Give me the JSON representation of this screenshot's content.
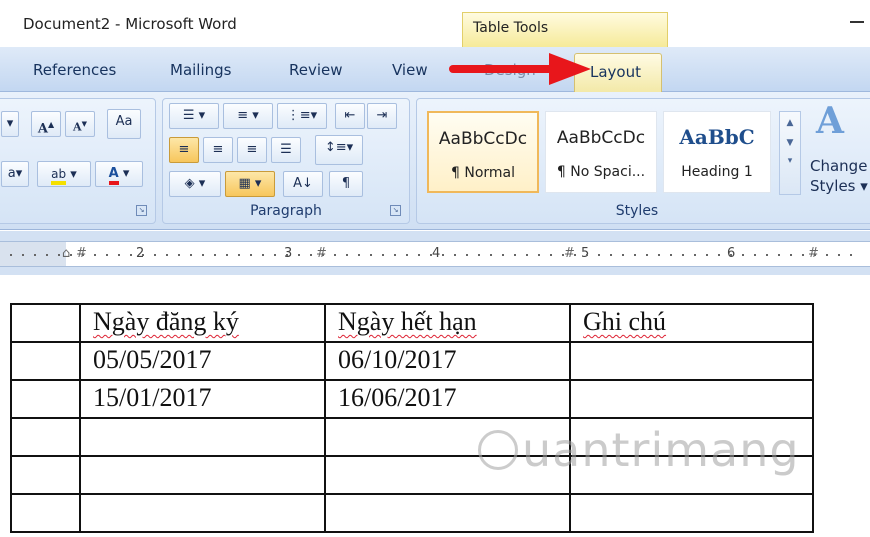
{
  "window": {
    "title": "Document2 - Microsoft Word",
    "contextual_tab_group": "Table Tools"
  },
  "tabs": {
    "references": "References",
    "mailings": "Mailings",
    "review": "Review",
    "view": "View",
    "design": "Design",
    "layout": "Layout"
  },
  "ribbon": {
    "groups": {
      "paragraph": "Paragraph",
      "styles": "Styles"
    },
    "styles": [
      {
        "sample": "AaBbCcDc",
        "name": "¶ Normal"
      },
      {
        "sample": "AaBbCcDc",
        "name": "¶ No Spaci..."
      },
      {
        "sample": "AaBbC",
        "name": "Heading 1"
      }
    ],
    "change_styles": {
      "line1": "Change",
      "line2": "Styles ▾"
    },
    "font_buttons": {
      "grow": "A",
      "shrink": "A",
      "highlight": "ab",
      "color": "A"
    }
  },
  "ruler": {
    "numbers": [
      "2",
      "3",
      "4",
      "5",
      "6"
    ]
  },
  "table": {
    "rows": [
      [
        "",
        "Ngày đăng ký",
        "Ngày hết hạn",
        "Ghi chú"
      ],
      [
        "",
        "05/05/2017",
        "06/10/2017",
        ""
      ],
      [
        "",
        "15/01/2017",
        "16/06/2017",
        ""
      ],
      [
        "",
        "",
        "",
        ""
      ],
      [
        "",
        "",
        "",
        ""
      ],
      [
        "",
        "",
        "",
        ""
      ]
    ]
  },
  "watermark": {
    "text": "uantrimang"
  },
  "colors": {
    "ribbon_blue": "#cfdff3",
    "table_tools_yellow": "#f6ea99",
    "arrow_red": "#e8161b"
  }
}
